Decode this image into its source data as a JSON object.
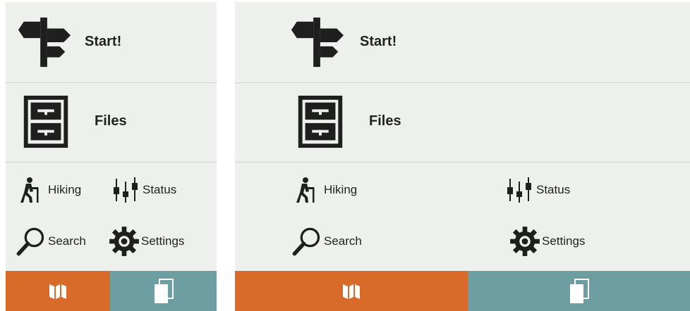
{
  "colors": {
    "screen_bg": "#eef0ed",
    "map_tab": "#d86a2a",
    "pages_tab": "#6d9ea2",
    "icon": "#1f1f1f"
  },
  "small_screen": {
    "start_label": "Start!",
    "files_label": "Files",
    "hiking_label": "Hiking",
    "status_label": "Status",
    "search_label": "Search",
    "settings_label": "Settings",
    "icons": [
      "signpost-icon",
      "file-cabinet-icon",
      "hiker-icon",
      "sliders-icon",
      "magnifier-icon",
      "gear-icon",
      "map-icon",
      "pages-icon"
    ]
  },
  "large_screen": {
    "start_label": "Start!",
    "files_label": "Files",
    "hiking_label": "Hiking",
    "status_label": "Status",
    "search_label": "Search",
    "settings_label": "Settings",
    "icons": [
      "signpost-icon",
      "file-cabinet-icon",
      "hiker-icon",
      "sliders-icon",
      "magnifier-icon",
      "gear-icon",
      "map-icon",
      "pages-icon"
    ]
  }
}
